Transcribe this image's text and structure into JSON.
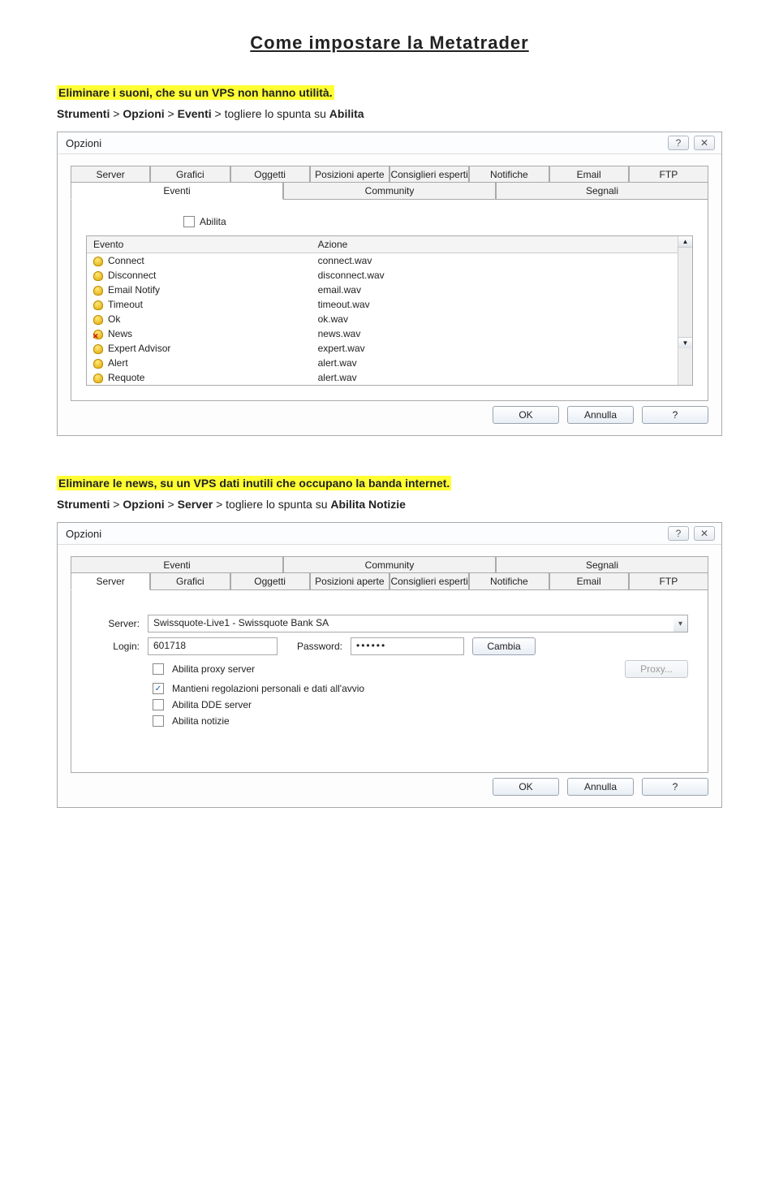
{
  "page_title": "Come impostare la Metatrader",
  "section1": {
    "highlight": "Eliminare i suoni, che su un VPS non hanno utilità.",
    "path_prefix1": "Strumenti",
    "path_prefix2": "Opzioni",
    "path_prefix3": "Eventi",
    "path_action": "togliere lo spunta su",
    "path_target": "Abilita"
  },
  "section2": {
    "highlight": "Eliminare le news, su un VPS dati inutili che occupano la banda internet.",
    "path_prefix1": "Strumenti",
    "path_prefix2": "Opzioni",
    "path_prefix3": "Server",
    "path_action": "togliere lo spunta su",
    "path_target": "Abilita Notizie"
  },
  "dialog_common": {
    "title": "Opzioni",
    "help_btn": "?",
    "close_btn": "✕",
    "ok": "OK",
    "cancel": "Annulla",
    "help": "?"
  },
  "dialog1": {
    "tabs_row1": [
      "Server",
      "Grafici",
      "Oggetti",
      "Posizioni aperte",
      "Consiglieri esperti",
      "Notifiche",
      "Email",
      "FTP"
    ],
    "tabs_row2": [
      "Eventi",
      "Community",
      "Segnali"
    ],
    "active_tab": "Eventi",
    "enable_label": "Abilita",
    "table_headers": [
      "Evento",
      "Azione"
    ],
    "events": [
      {
        "name": "Connect",
        "file": "connect.wav",
        "muted": false
      },
      {
        "name": "Disconnect",
        "file": "disconnect.wav",
        "muted": false
      },
      {
        "name": "Email Notify",
        "file": "email.wav",
        "muted": false
      },
      {
        "name": "Timeout",
        "file": "timeout.wav",
        "muted": false
      },
      {
        "name": "Ok",
        "file": "ok.wav",
        "muted": false
      },
      {
        "name": "News",
        "file": "news.wav",
        "muted": true
      },
      {
        "name": "Expert Advisor",
        "file": "expert.wav",
        "muted": false
      },
      {
        "name": "Alert",
        "file": "alert.wav",
        "muted": false
      },
      {
        "name": "Requote",
        "file": "alert.wav",
        "muted": false
      }
    ]
  },
  "dialog2": {
    "tabs_row1": [
      "Eventi",
      "Community",
      "Segnali"
    ],
    "tabs_row2": [
      "Server",
      "Grafici",
      "Oggetti",
      "Posizioni aperte",
      "Consiglieri esperti",
      "Notifiche",
      "Email",
      "FTP"
    ],
    "active_tab": "Server",
    "server_label": "Server:",
    "server_value": "Swissquote-Live1 - Swissquote Bank SA",
    "login_label": "Login:",
    "login_value": "601718",
    "password_label": "Password:",
    "password_value": "••••••",
    "change_btn": "Cambia",
    "proxy_btn": "Proxy...",
    "cb_proxy": "Abilita proxy server",
    "cb_keep": "Mantieni regolazioni personali e dati all'avvio",
    "cb_dde": "Abilita DDE server",
    "cb_news": "Abilita notizie"
  }
}
